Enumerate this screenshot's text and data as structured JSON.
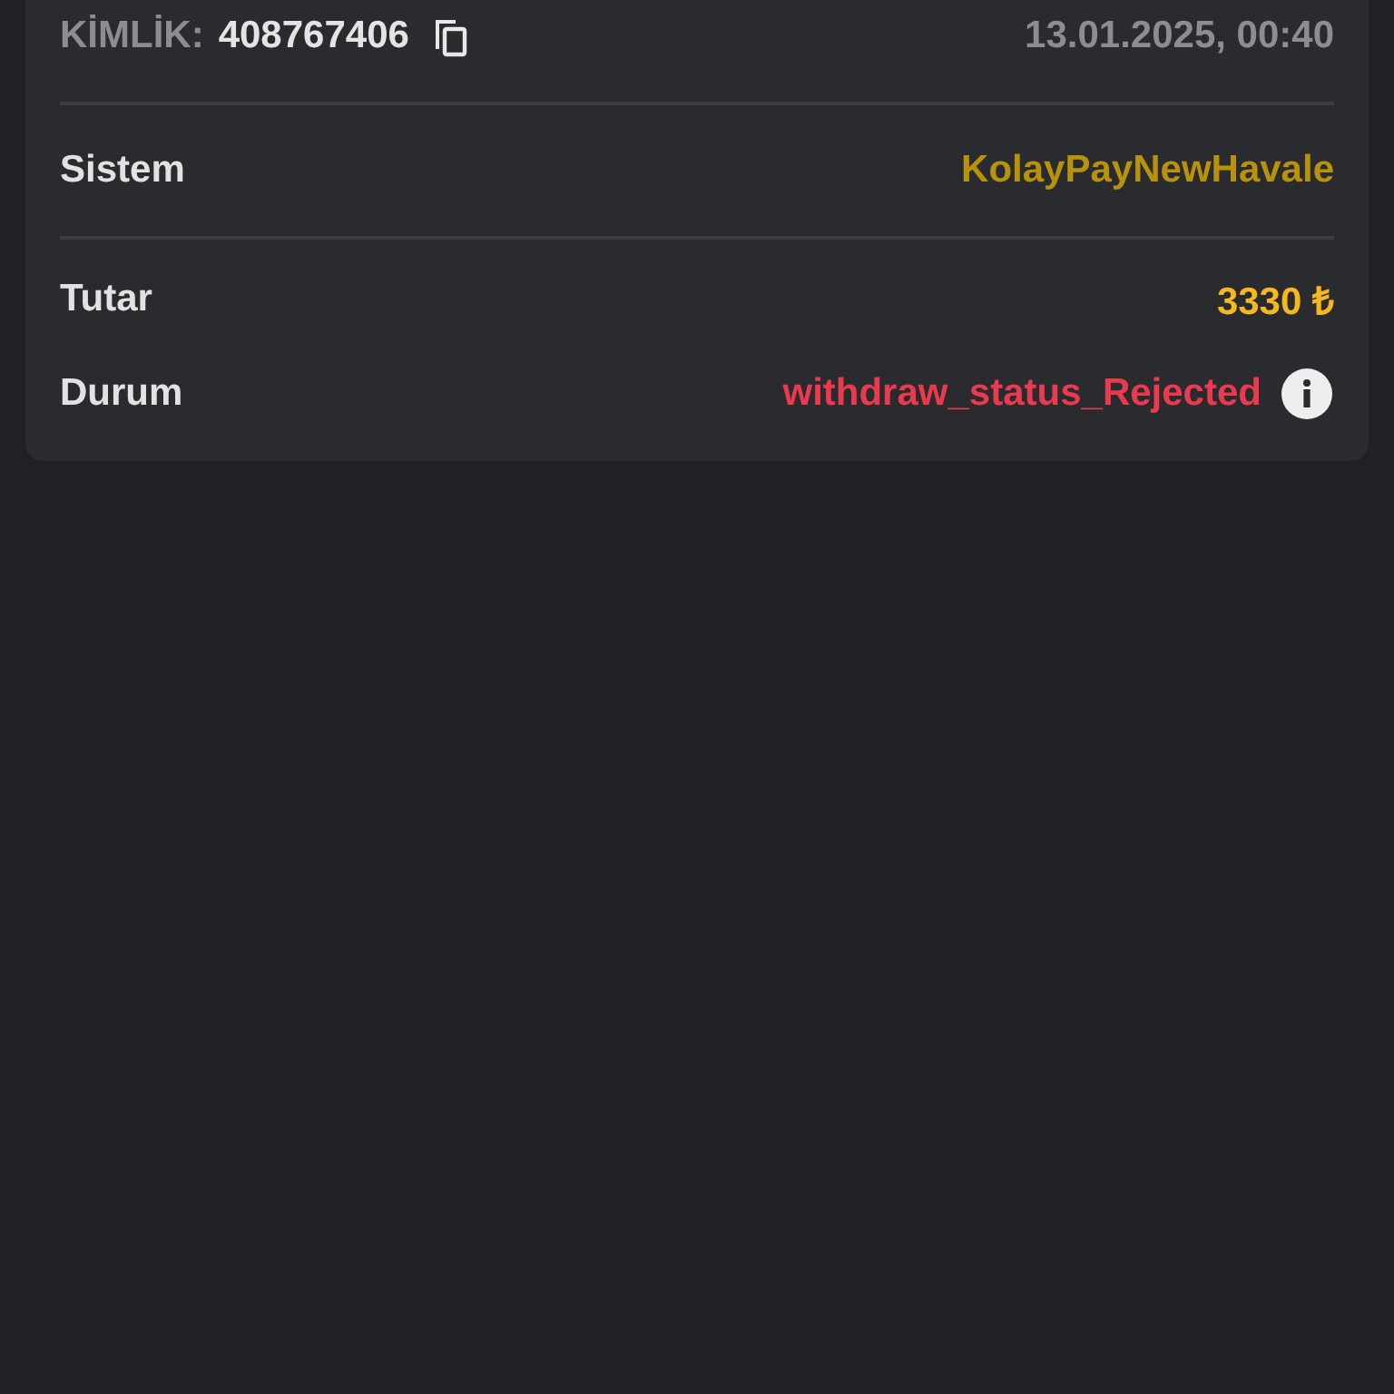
{
  "header": {
    "id_label": "KİMLİK:",
    "id_value": "408767406",
    "date": "13.01.2025, 00:40"
  },
  "sections": [
    {
      "rows": [
        {
          "label": "Sistem",
          "value": "KolayPayNewHavale",
          "color": "#b8920c",
          "info": false
        }
      ]
    },
    {
      "rows": [
        {
          "label": "Tutar",
          "value": "3330 ₺",
          "color": "#f5b820",
          "info": false
        },
        {
          "label": "Durum",
          "value": "withdraw_status_Rejected",
          "color": "#ea3a4f",
          "info": true
        }
      ]
    }
  ]
}
